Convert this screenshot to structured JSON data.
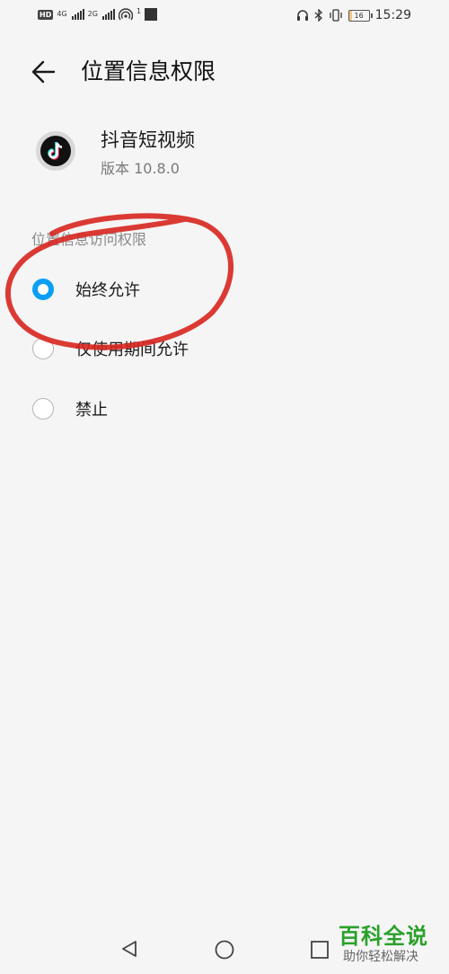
{
  "status_bar": {
    "hd": "HD",
    "net1": "4G",
    "net2": "2G",
    "notif_count": "1",
    "time": "15:29",
    "battery": "16",
    "battery_level_percent": 16
  },
  "header": {
    "title": "位置信息权限"
  },
  "app": {
    "name": "抖音短视频",
    "version": "版本 10.8.0",
    "icon": "tiktok-icon"
  },
  "section_label": "位置信息访问权限",
  "options": [
    {
      "label": "始终允许",
      "selected": true
    },
    {
      "label": "仅使用期间允许",
      "selected": false
    },
    {
      "label": "禁止",
      "selected": false
    }
  ],
  "annotation": {
    "color": "#d8261f"
  },
  "accent_color": "#0a9ff5",
  "watermark": {
    "title": "百科全说",
    "subtitle": "助你轻松解决"
  }
}
